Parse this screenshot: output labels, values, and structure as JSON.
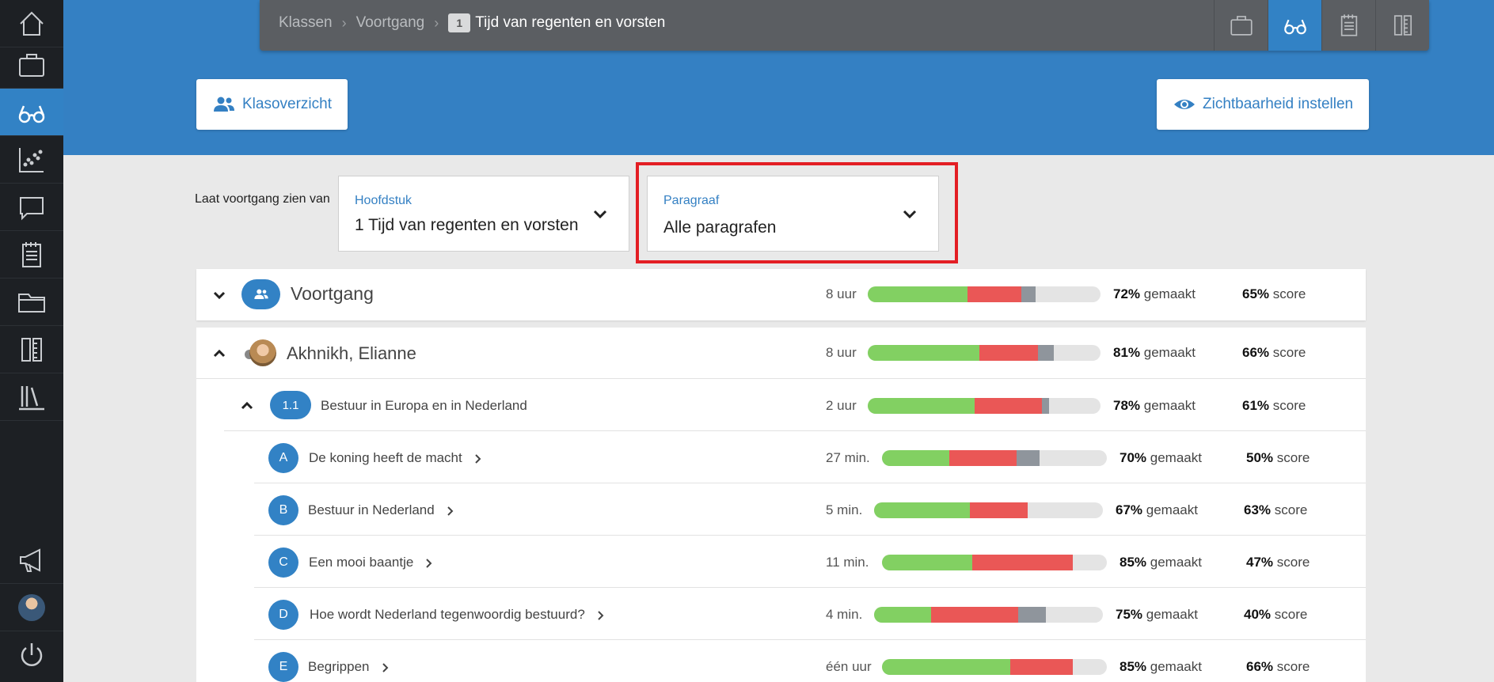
{
  "breadcrumb": {
    "items": [
      "Klassen",
      "Voortgang"
    ],
    "badge": "1",
    "current": "Tijd van regenten en vorsten"
  },
  "buttons": {
    "class_overview": "Klasoverzicht",
    "visibility": "Zichtbaarheid instellen"
  },
  "filters": {
    "label": "Laat voortgang zien van",
    "chapter": {
      "label": "Hoofdstuk",
      "value": "1 Tijd van regenten en vorsten"
    },
    "paragraph": {
      "label": "Paragraaf",
      "value": "Alle paragrafen"
    }
  },
  "summary": {
    "title": "Voortgang",
    "time": "8 uur",
    "made": "72%",
    "made_label": "gemaakt",
    "score": "65%",
    "score_label": "score",
    "bar": {
      "green": 0.43,
      "red": 0.23,
      "gray": 0.06
    }
  },
  "student": {
    "name": "Akhnikh, Elianne",
    "time": "8 uur",
    "made": "81%",
    "made_label": "gemaakt",
    "score": "66%",
    "score_label": "score",
    "bar": {
      "green": 0.48,
      "red": 0.25,
      "gray": 0.07
    }
  },
  "section": {
    "number": "1.1",
    "title": "Bestuur in Europa en in Nederland",
    "time": "2 uur",
    "made": "78%",
    "made_label": "gemaakt",
    "score": "61%",
    "score_label": "score",
    "bar": {
      "green": 0.46,
      "red": 0.29,
      "gray": 0.03
    }
  },
  "lessons": [
    {
      "letter": "A",
      "title": "De koning heeft de macht",
      "time": "27 min.",
      "made": "70%",
      "made_label": "gemaakt",
      "score": "50%",
      "score_label": "score",
      "bar": {
        "green": 0.3,
        "red": 0.3,
        "gray": 0.1
      }
    },
    {
      "letter": "B",
      "title": "Bestuur in Nederland",
      "time": "5 min.",
      "made": "67%",
      "made_label": "gemaakt",
      "score": "63%",
      "score_label": "score",
      "bar": {
        "green": 0.42,
        "red": 0.25,
        "gray": 0.0
      }
    },
    {
      "letter": "C",
      "title": "Een mooi baantje",
      "time": "11 min.",
      "made": "85%",
      "made_label": "gemaakt",
      "score": "47%",
      "score_label": "score",
      "bar": {
        "green": 0.4,
        "red": 0.45,
        "gray": 0.0
      }
    },
    {
      "letter": "D",
      "title": "Hoe wordt Nederland tegenwoordig bestuurd?",
      "time": "4 min.",
      "made": "75%",
      "made_label": "gemaakt",
      "score": "40%",
      "score_label": "score",
      "bar": {
        "green": 0.25,
        "red": 0.38,
        "gray": 0.12
      }
    },
    {
      "letter": "E",
      "title": "Begrippen",
      "time": "één uur",
      "made": "85%",
      "made_label": "gemaakt",
      "score": "66%",
      "score_label": "score",
      "bar": {
        "green": 0.57,
        "red": 0.28,
        "gray": 0.0
      }
    }
  ],
  "colors": {
    "accent": "#3282c5",
    "header": "#3480c3",
    "sidebar": "#1d2024",
    "bar_done_correct": "#82d062",
    "bar_done_wrong": "#ea5756",
    "bar_other": "#8f959c",
    "highlight": "#e31e24"
  },
  "icons": {
    "sidebar": [
      "home-icon",
      "briefcase-icon",
      "glasses-icon",
      "scatter-chart-icon",
      "chat-icon",
      "notepad-icon",
      "folder-icon",
      "book-ruler-icon",
      "library-icon",
      "megaphone-icon",
      "user-avatar",
      "power-icon"
    ],
    "top_tabs": [
      "briefcase-icon",
      "glasses-icon",
      "notepad-icon",
      "book-ruler-icon"
    ]
  }
}
